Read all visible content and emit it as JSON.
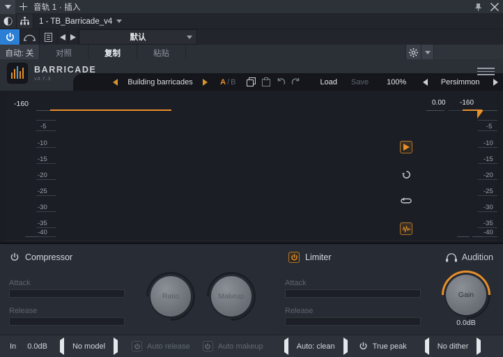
{
  "host": {
    "titlebar": {
      "dropdown_icon": "chevron-down-icon",
      "add_icon": "plus-icon",
      "title": "音轨 1 · 插入",
      "pin_icon": "pin-icon",
      "close_icon": "close-icon"
    },
    "slot_row": {
      "bypass_icon": "power-circle-icon",
      "routing_icon": "routing-icon",
      "slot_label": "1 - TB_Barricade_v4"
    },
    "control_row": {
      "power_icon": "power-icon",
      "curve_icon": "arc-icon",
      "list_icon": "list-icon",
      "prev_icon": "triangle-left-icon",
      "next_icon": "triangle-right-icon",
      "preset_label": "默认"
    },
    "auto_row": {
      "auto_label": "自动: 关",
      "compare_label": "对照",
      "copy_label": "复制",
      "paste_label": "粘贴",
      "gear_icon": "gear-icon",
      "gear_caret_icon": "chevron-down-icon"
    }
  },
  "plugin": {
    "brand": {
      "name": "BARRICADE",
      "version": "v4.7.3",
      "logo_icon": "bars-logo-icon",
      "menu_icon": "hamburger-icon"
    },
    "toolbar": {
      "prev_icon": "triangle-left-icon",
      "preset_name": "Building barricades",
      "next_icon": "triangle-right-icon",
      "ab_a": "A",
      "ab_slash": "/",
      "ab_b": "B",
      "copy_icon": "copy-icon",
      "paste_icon": "paste-icon",
      "undo_icon": "undo-icon",
      "redo_icon": "redo-icon",
      "load_label": "Load",
      "save_label": "Save",
      "zoom_label": "100%",
      "theme_prev_icon": "triangle-left-icon",
      "theme_name": "Persimmon",
      "theme_next_icon": "triangle-right-icon"
    },
    "graph": {
      "left_top_label": "-160",
      "left_ticks": [
        "-5",
        "-10",
        "-15",
        "-20",
        "-25",
        "-30",
        "-35",
        "-40"
      ],
      "right_ticks": [
        "-5",
        "-10",
        "-15",
        "-20",
        "-25",
        "-30",
        "-35",
        "-40"
      ],
      "readout_left": "0.00",
      "readout_right": "-160",
      "threshold_color": "#e8902a",
      "side_icons": [
        {
          "name": "play-icon",
          "style": "box",
          "active": true
        },
        {
          "name": "reset-icon",
          "style": "plain",
          "active": false
        },
        {
          "name": "loop-icon",
          "style": "plain",
          "active": false
        },
        {
          "name": "waveform-icon",
          "style": "box",
          "active": true
        }
      ]
    },
    "compressor": {
      "power_icon": "power-icon",
      "title": "Compressor",
      "attack_label": "Attack",
      "release_label": "Release",
      "ratio_label": "Ratio",
      "makeup_label": "Makeup",
      "enabled": false
    },
    "limiter": {
      "power_icon": "power-icon",
      "title": "Limiter",
      "attack_label": "Attack",
      "release_label": "Release",
      "gain_label": "Gain",
      "gain_value": "0.0dB",
      "enabled": true
    },
    "audition": {
      "icon": "headphones-icon",
      "label": "Audition"
    },
    "footer": {
      "in_label": "In",
      "in_value": "0.0dB",
      "model_prev_icon": "triangle-left-icon",
      "model_label": "No model",
      "model_next_icon": "triangle-right-icon",
      "auto_release_label": "Auto release",
      "auto_release_icon": "power-icon",
      "auto_makeup_label": "Auto makeup",
      "auto_makeup_icon": "power-icon",
      "mode_prev_icon": "triangle-left-icon",
      "mode_label": "Auto: clean",
      "mode_next_icon": "triangle-right-icon",
      "truepeak_icon": "power-icon",
      "truepeak_label": "True peak",
      "dither_prev_icon": "triangle-left-icon",
      "dither_label": "No dither",
      "dither_next_icon": "triangle-right-icon"
    }
  }
}
